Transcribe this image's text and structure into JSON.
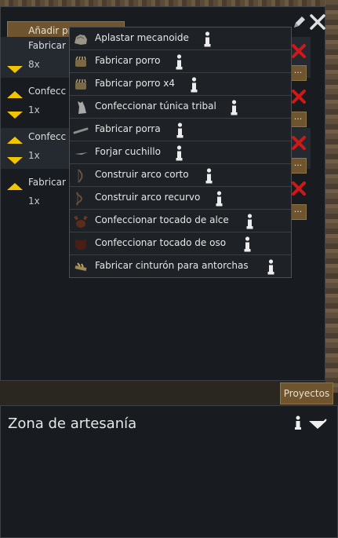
{
  "panel": {
    "add_button": "Añadir proyecto"
  },
  "bills": [
    {
      "title": "Fabricar",
      "count": "8x"
    },
    {
      "title": "Confecc",
      "count": "1x"
    },
    {
      "title": "Confecc",
      "count": "1x"
    },
    {
      "title": "Fabricar",
      "count": "1x"
    }
  ],
  "details_label": "...",
  "menu": {
    "items": [
      {
        "label": "Aplastar mecanoide",
        "icon": "mechanoid-icon"
      },
      {
        "label": "Fabricar porro",
        "icon": "joint-icon"
      },
      {
        "label": "Fabricar porro x4",
        "icon": "joint-icon"
      },
      {
        "label": "Confeccionar túnica tribal",
        "icon": "tribal-tunic-icon"
      },
      {
        "label": "Fabricar porra",
        "icon": "club-icon"
      },
      {
        "label": "Forjar cuchillo",
        "icon": "knife-icon"
      },
      {
        "label": "Construir arco corto",
        "icon": "short-bow-icon"
      },
      {
        "label": "Construir arco recurvo",
        "icon": "recurve-bow-icon"
      },
      {
        "label": "Confeccionar tocado de alce",
        "icon": "elk-headdress-icon"
      },
      {
        "label": "Confeccionar tocado de oso",
        "icon": "bear-headdress-icon"
      },
      {
        "label": "Fabricar cinturón para antorchas",
        "icon": "torch-belt-icon"
      }
    ]
  },
  "projects_button": "Proyectos",
  "inspect": {
    "title": "Zona de artesanía"
  },
  "colors": {
    "accent_button": "#6e5530",
    "arrow": "#f2c400",
    "delete": "#d01818",
    "panel": "#181c21"
  }
}
